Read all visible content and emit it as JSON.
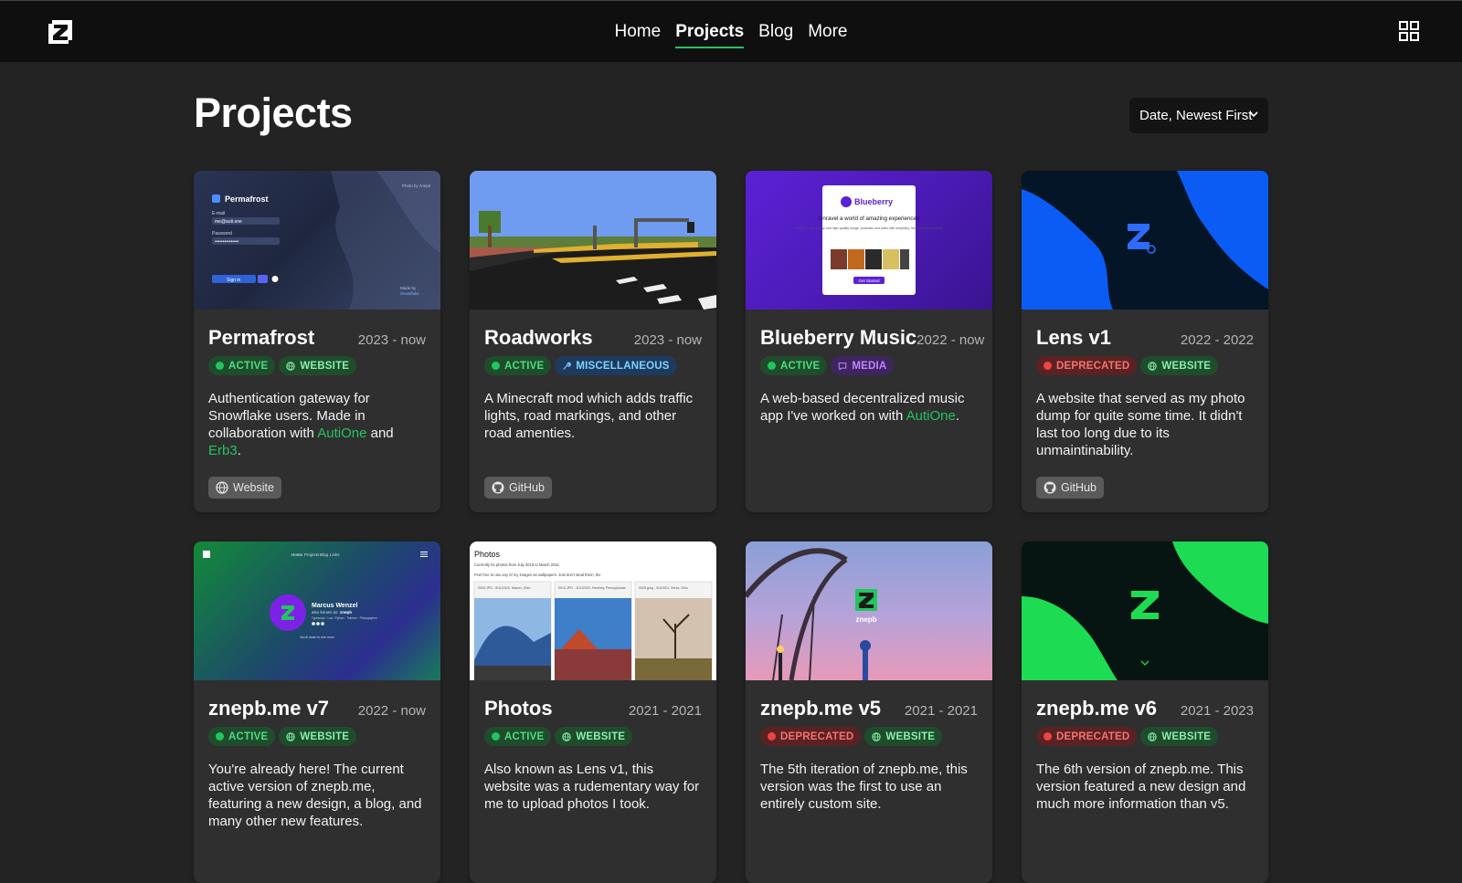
{
  "nav": {
    "items": [
      "Home",
      "Projects",
      "Blog",
      "More"
    ],
    "active": "Projects"
  },
  "page": {
    "title": "Projects",
    "sort_value": "Date, Newest First"
  },
  "colors": {
    "accent": "#22c55e",
    "deprecated": "#ef4444",
    "background": "#232323",
    "card": "#2f2f2f"
  },
  "cards": [
    {
      "title": "Permafrost",
      "date": "2023 - now",
      "status": "ACTIVE",
      "category": "WEBSITE",
      "desc_parts": [
        "Authentication gateway for Snowflake users. Made in collaboration with ",
        "AutiOne",
        " and ",
        "Erb3",
        "."
      ],
      "link": "Website",
      "thumb": {
        "brand": "Permafrost",
        "photo_by": "Photo by znepb",
        "email_label": "E-mail",
        "email_value": "me@auti.one",
        "password_label": "Password",
        "password_value": "•••••••••••••••",
        "signin": "Sign in",
        "made_by": "Made by",
        "made_by_name": "Snowflake"
      }
    },
    {
      "title": "Roadworks",
      "date": "2023 - now",
      "status": "ACTIVE",
      "category": "MISCELLANEOUS",
      "desc_parts": [
        "A Minecraft mod which adds traffic lights, road markings, and other road amenties."
      ],
      "link": "GitHub"
    },
    {
      "title": "Blueberry Music",
      "date": "2022 - now",
      "status": "ACTIVE",
      "category": "MEDIA",
      "desc_parts": [
        "A web-based decentralized music app I've worked on with ",
        "AutiOne",
        "."
      ],
      "link": "",
      "thumb": {
        "brand": "Blueberry",
        "headline": "Unravel a world of amazing experiences",
        "body": "Listen to high-fidelity and high-quality songs, podcasts and radio with simplicity, modernity and beauty.",
        "cta": "Get Started"
      }
    },
    {
      "title": "Lens v1",
      "date": "2022 - 2022",
      "status": "DEPRECATED",
      "category": "WEBSITE",
      "desc_parts": [
        "A website that served as my photo dump for quite some time. It didn't last too long due to its unmaintinability."
      ],
      "link": "GitHub"
    },
    {
      "title": "znepb.me v7",
      "date": "2022 - now",
      "status": "ACTIVE",
      "category": "WEBSITE",
      "desc_parts": [
        "You're already here! The current active version of znepb.me, featuring a new design, a blog, and many other new features."
      ],
      "link": "",
      "thumb": {
        "nav": [
          "Home",
          "Projects",
          "Blog",
          "Links"
        ],
        "name": "Marcus Wenzel",
        "alias_prefix": "also known as",
        "alias": "znepb",
        "tagline": "Typescript · Lua · Python · Tinkerer · Photographer",
        "scroll": "Scroll down to see more"
      }
    },
    {
      "title": "Photos",
      "date": "2021 - 2021",
      "status": "ACTIVE",
      "category": "WEBSITE",
      "desc_parts": [
        "Also known as Lens v1, this website was a rudementary way for me to upload photos I took."
      ],
      "link": "",
      "thumb": {
        "heading": "Photos",
        "line1": "Currently 51 photos from July 2019 to March 2021.",
        "line2": "Feel free to use any of my images as wallpapers. Just don't steal them, thx",
        "captions": [
          "0000.JPG - 8/11/2020, Mason, Ohio",
          "0014.JPG - 11/1/2020, Hershey, Pennsylvania",
          "0029.jpeg - 3/4/2021, Xenia, Ohio"
        ]
      }
    },
    {
      "title": "znepb.me v5",
      "date": "2021 - 2021",
      "status": "DEPRECATED",
      "category": "WEBSITE",
      "desc_parts": [
        "The 5th iteration of znepb.me, this version was the first to use an entirely custom site."
      ],
      "link": "",
      "thumb": {
        "label": "znepb"
      }
    },
    {
      "title": "znepb.me v6",
      "date": "2021 - 2023",
      "status": "DEPRECATED",
      "category": "WEBSITE",
      "desc_parts": [
        "The 6th version of znepb.me. This version featured a new design and much more information than v5."
      ],
      "link": ""
    }
  ]
}
